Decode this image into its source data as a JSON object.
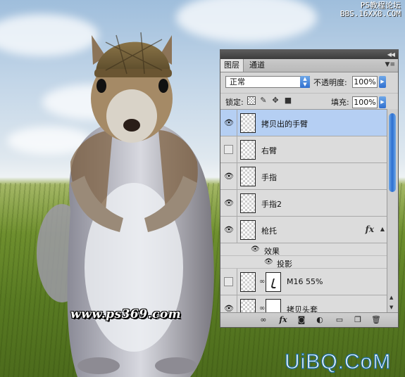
{
  "watermark": {
    "top_line1": "PS教程论坛",
    "top_line2": "BBS.16XX8.COM",
    "ps_site": "www.ps369.com",
    "logo_text": "UiBQ.CoM"
  },
  "layers_panel": {
    "tabs": [
      {
        "label": "图层",
        "active": true
      },
      {
        "label": "通道",
        "active": false
      }
    ],
    "blend_mode": "正常",
    "opacity_label": "不透明度:",
    "opacity_value": "100%",
    "lock_label": "锁定:",
    "fill_label": "填充:",
    "fill_value": "100%",
    "layers": [
      {
        "name": "拷贝出的手臂",
        "visible": true,
        "selected": true
      },
      {
        "name": "右臂",
        "visible": false,
        "selected": false
      },
      {
        "name": "手指",
        "visible": true,
        "selected": false
      },
      {
        "name": "手指2",
        "visible": true,
        "selected": false
      },
      {
        "name": "枪托",
        "visible": true,
        "selected": false,
        "fx": "fx"
      },
      {
        "name": "M16 55%",
        "visible": false,
        "selected": false
      },
      {
        "name": "拷贝头套",
        "visible": true,
        "selected": false
      }
    ],
    "effects": {
      "label": "效果",
      "items": [
        "投影"
      ]
    },
    "bottom_icons": [
      "link-icon",
      "fx-icon",
      "mask-icon",
      "adjustment-icon",
      "group-folder-icon",
      "new-layer-icon",
      "trash-icon"
    ],
    "selected_color": "#b5cff3"
  }
}
